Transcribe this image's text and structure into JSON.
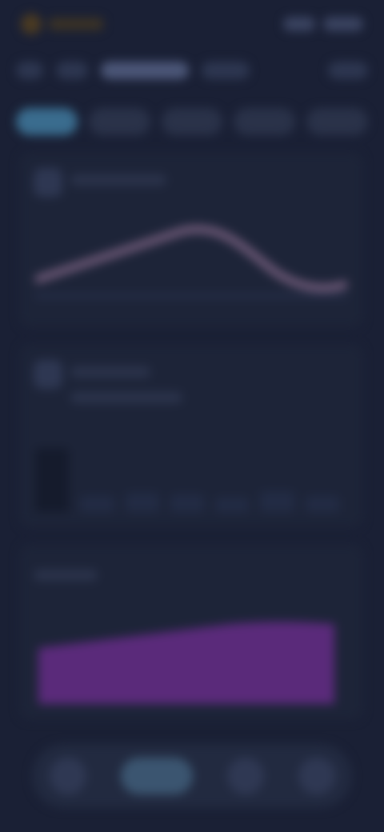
{
  "colors": {
    "background": "#1a2035",
    "card": "#1d2438",
    "accent_teal": "#3a6c8e",
    "accent_purple": "#6a2a8a",
    "line_pink": "#9a6a86"
  },
  "topbar": {
    "brand_icon": "logo-icon"
  },
  "tabs": [
    {
      "active": true
    },
    {
      "active": false
    },
    {
      "active": false
    },
    {
      "active": false
    },
    {
      "active": false
    }
  ],
  "bottom_nav": [
    {
      "icon": "home-icon",
      "active": false
    },
    {
      "icon": "chart-icon",
      "active": true
    },
    {
      "icon": "calendar-icon",
      "active": false
    },
    {
      "icon": "profile-icon",
      "active": false
    }
  ]
}
